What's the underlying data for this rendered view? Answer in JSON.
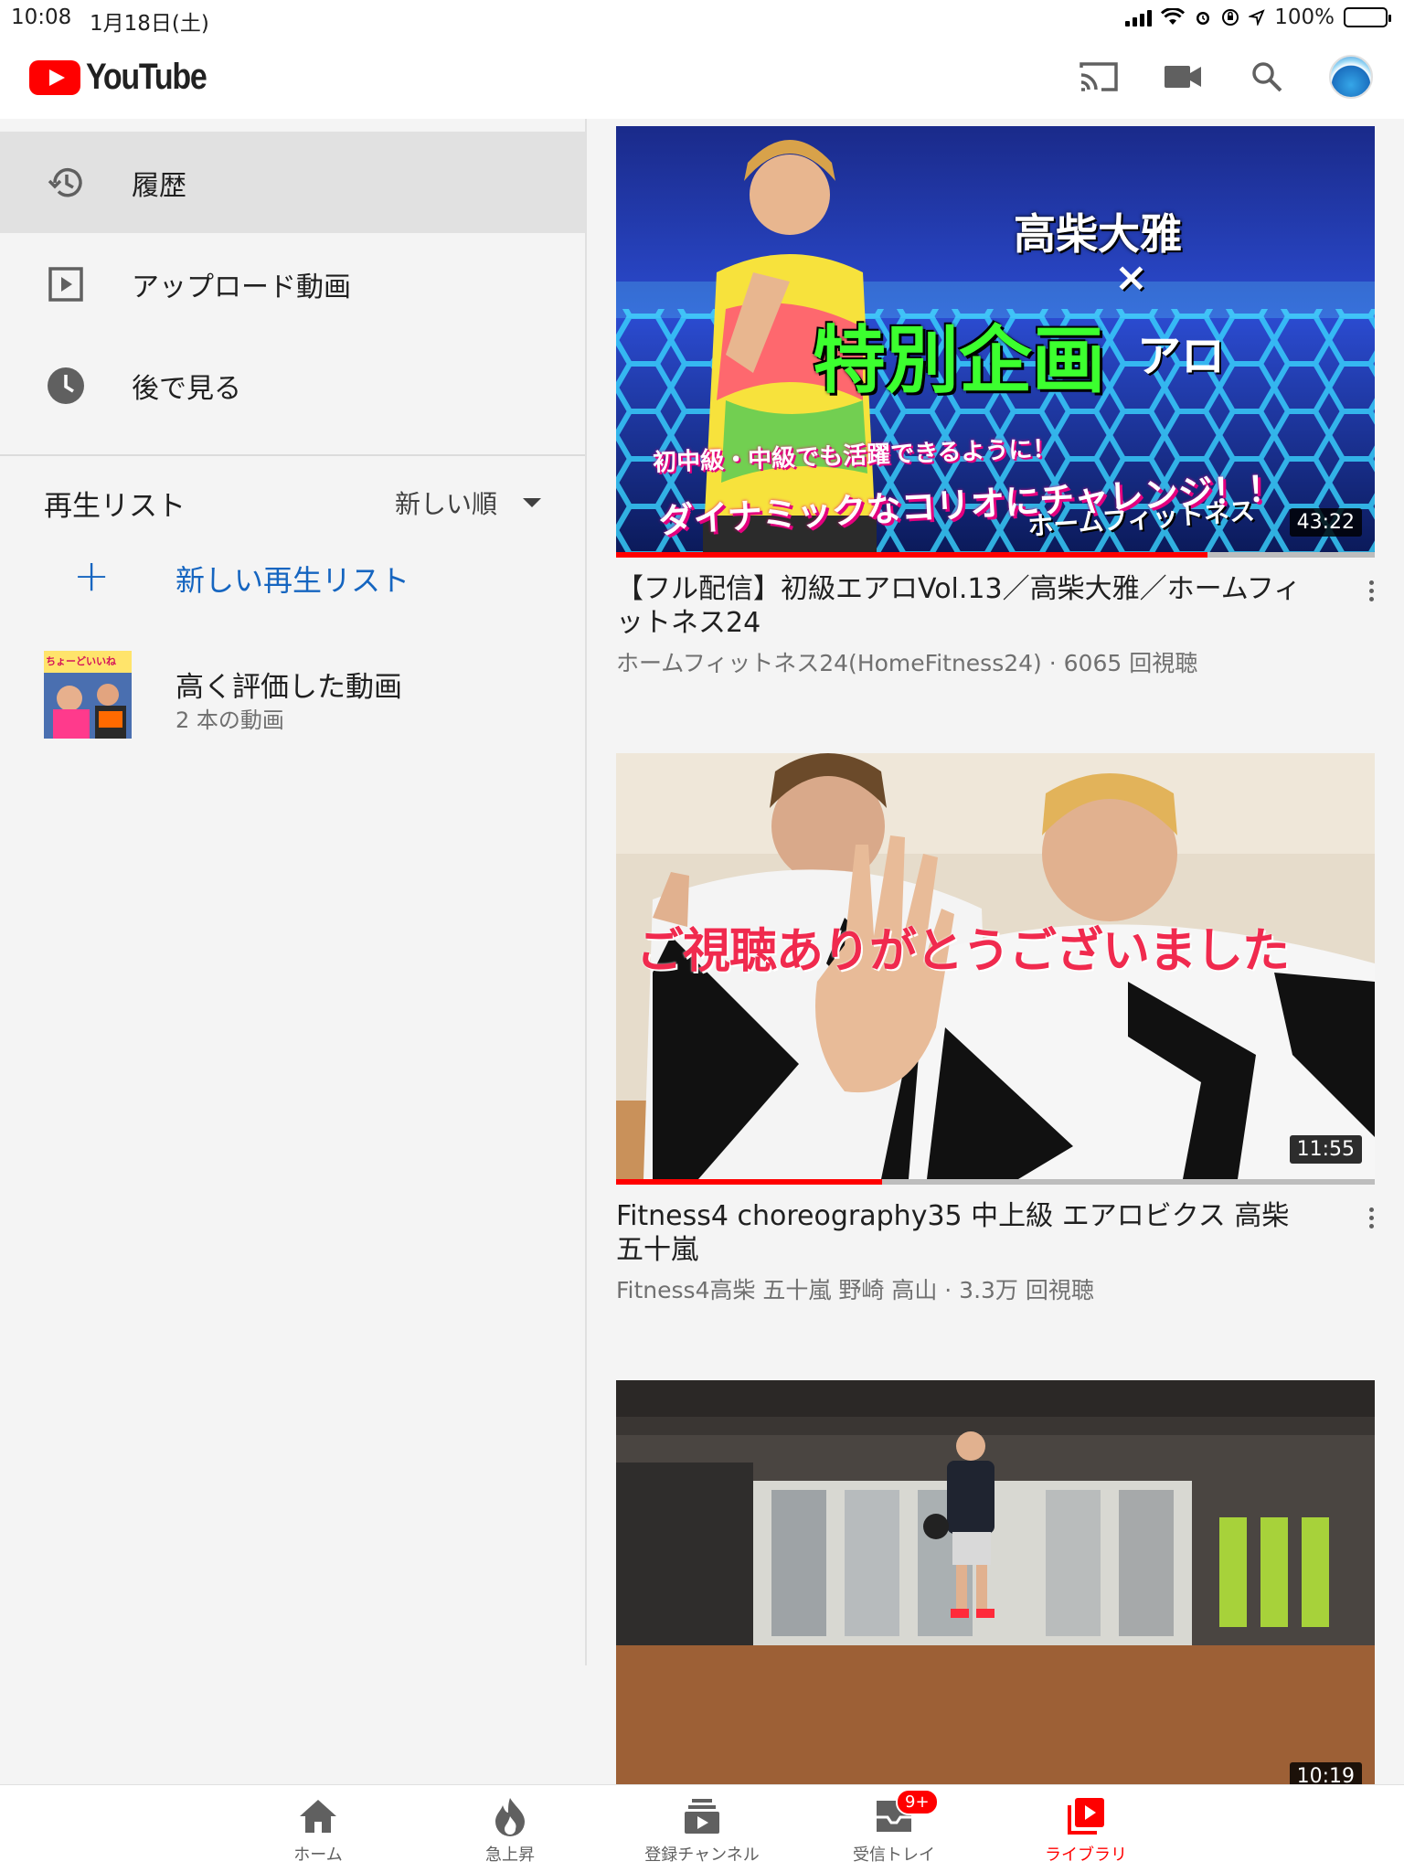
{
  "status_bar": {
    "time": "10:08",
    "date": "1月18日(土)",
    "battery_text": "100%",
    "battery_color": "#34c759"
  },
  "app": {
    "logo_text": "YouTube",
    "brand_color": "#ff0000",
    "link_color": "#1565c0"
  },
  "header_actions": [
    {
      "name": "cast-icon"
    },
    {
      "name": "video-camera-icon"
    },
    {
      "name": "search-icon"
    },
    {
      "name": "account-avatar"
    }
  ],
  "library": {
    "nav": [
      {
        "label": "履歴",
        "icon": "history-icon",
        "active": true
      },
      {
        "label": "アップロード動画",
        "icon": "upload-video-icon",
        "active": false
      },
      {
        "label": "後で見る",
        "icon": "clock-icon",
        "active": false
      }
    ],
    "playlists": {
      "title": "再生リスト",
      "sort_label": "新しい順",
      "new_playlist_label": "新しい再生リスト",
      "liked": {
        "title": "高く評価した動画",
        "count_text": "2 本の動画",
        "thumb_text": "ちょーどいいね"
      }
    }
  },
  "videos": [
    {
      "title": "【フル配信】初級エアロVol.13／高柴大雅／ホームフィットネス24",
      "meta": "ホームフィットネス24(HomeFitness24) · 6065 回視聴",
      "duration": "43:22",
      "progress": 0.78,
      "thumb_text": {
        "name": "高柴大雅",
        "x": "×",
        "special": "特別企画",
        "aero": "アロ",
        "line1": "初中級・中級でも活躍できるように！",
        "line2": "ダイナミックなコリオにチャレンジ！！",
        "brand": "ホームフィットネス"
      }
    },
    {
      "title": "Fitness4 choreography35 中上級 エアロビクス 高柴 五十嵐",
      "meta": "Fitness4高柴 五十嵐 野崎 高山 · 3.3万 回視聴",
      "duration": "11:55",
      "progress": 0.35,
      "thumb_text": {
        "caption": "ご視聴ありがとうございました"
      }
    },
    {
      "title": "",
      "meta": "",
      "duration": "10:19",
      "progress": 0
    }
  ],
  "bottom_nav": [
    {
      "label": "ホーム",
      "icon": "home-icon",
      "active": false
    },
    {
      "label": "急上昇",
      "icon": "trending-icon",
      "active": false
    },
    {
      "label": "登録チャンネル",
      "icon": "subscriptions-icon",
      "active": false
    },
    {
      "label": "受信トレイ",
      "icon": "inbox-icon",
      "active": false,
      "badge": "9+"
    },
    {
      "label": "ライブラリ",
      "icon": "library-icon",
      "active": true
    }
  ]
}
